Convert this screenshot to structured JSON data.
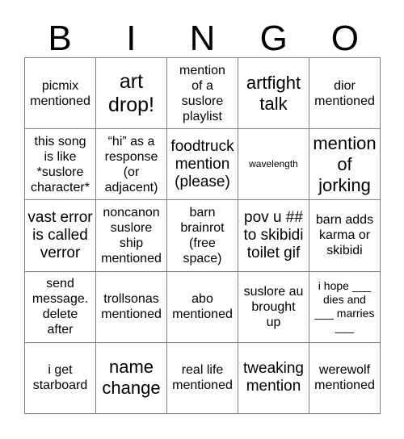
{
  "card": {
    "header_letters": [
      "B",
      "I",
      "N",
      "G",
      "O"
    ],
    "rows": [
      [
        {
          "text": "picmix\nmentioned",
          "size": "m"
        },
        {
          "text": "art\ndrop!",
          "size": "xxl"
        },
        {
          "text": "mention\nof a\nsuslore\nplaylist",
          "size": "m"
        },
        {
          "text": "artfight\ntalk",
          "size": "xl"
        },
        {
          "text": "dior\nmentioned",
          "size": "m"
        }
      ],
      [
        {
          "text": "this song\nis like\n*suslore\ncharacter*",
          "size": "m"
        },
        {
          "text": "“hi” as a\nresponse\n(or\nadjacent)",
          "size": "m"
        },
        {
          "text": "foodtruck\nmention\n(please)",
          "size": "l"
        },
        {
          "text": "wavelength",
          "size": "xs"
        },
        {
          "text": "mention\nof\njorking",
          "size": "xl"
        }
      ],
      [
        {
          "text": "vast error\nis called\nverror",
          "size": "l"
        },
        {
          "text": "noncanon\nsuslore\nship\nmentioned",
          "size": "m"
        },
        {
          "text": "barn\nbrainrot\n(free\nspace)",
          "size": "m"
        },
        {
          "text": "pov u ##\nto skibidi\ntoilet gif",
          "size": "l"
        },
        {
          "text": "barn adds\nkarma or\nskibidi",
          "size": "m"
        }
      ],
      [
        {
          "text": "send\nmessage.\ndelete\nafter",
          "size": "m"
        },
        {
          "text": "trollsonas\nmentioned",
          "size": "m"
        },
        {
          "text": "abo\nmentioned",
          "size": "m"
        },
        {
          "text": "suslore au\nbrought\nup",
          "size": "m"
        },
        {
          "text": "i hope ___\ndies and\n___ marries\n___",
          "size": "s"
        }
      ],
      [
        {
          "text": "i get\nstarboard",
          "size": "m"
        },
        {
          "text": "name\nchange",
          "size": "xl"
        },
        {
          "text": "real life\nmentioned",
          "size": "m"
        },
        {
          "text": "tweaking\nmention",
          "size": "l"
        },
        {
          "text": "werewolf\nmentioned",
          "size": "m"
        }
      ]
    ]
  },
  "colors": {
    "background": "#ffffff",
    "text": "#000000",
    "grid_line": "#808080"
  }
}
